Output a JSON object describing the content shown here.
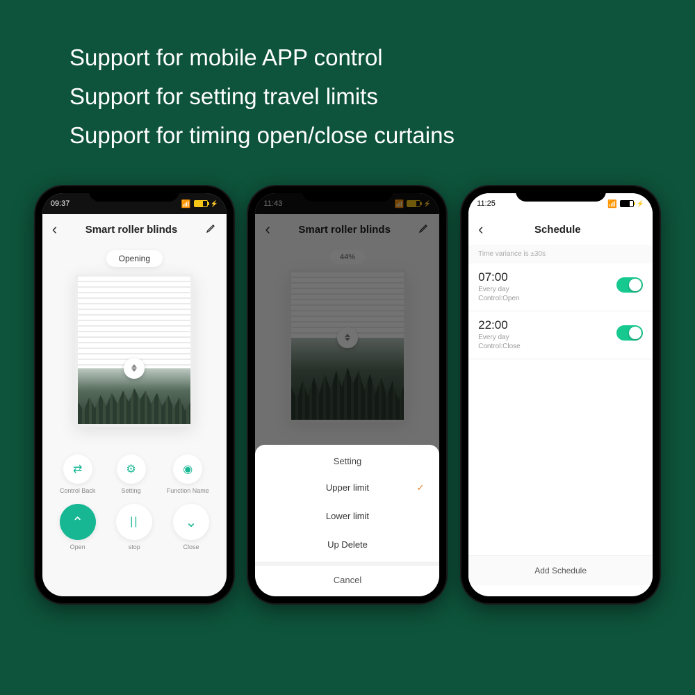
{
  "banner": {
    "line1": "Support for mobile APP control",
    "line2": "Support for setting travel limits",
    "line3": "Support for timing open/close curtains"
  },
  "phone1": {
    "time": "09:37",
    "title": "Smart roller blinds",
    "status_pill": "Opening",
    "ctrl_back": "Control Back",
    "ctrl_setting": "Setting",
    "ctrl_func": "Function Name",
    "open": "Open",
    "stop": "stop",
    "close": "Close"
  },
  "phone2": {
    "time": "11:43",
    "title": "Smart roller blinds",
    "percent": "44%",
    "sheet_title": "Setting",
    "opt_upper": "Upper limit",
    "opt_lower": "Lower limit",
    "opt_delete": "Up Delete",
    "cancel": "Cancel"
  },
  "phone3": {
    "time": "11:25",
    "title": "Schedule",
    "note": "Time variance is ±30s",
    "items": [
      {
        "time": "07:00",
        "repeat": "Every day",
        "control": "Control:Open"
      },
      {
        "time": "22:00",
        "repeat": "Every day",
        "control": "Control:Close"
      }
    ],
    "add": "Add Schedule"
  }
}
